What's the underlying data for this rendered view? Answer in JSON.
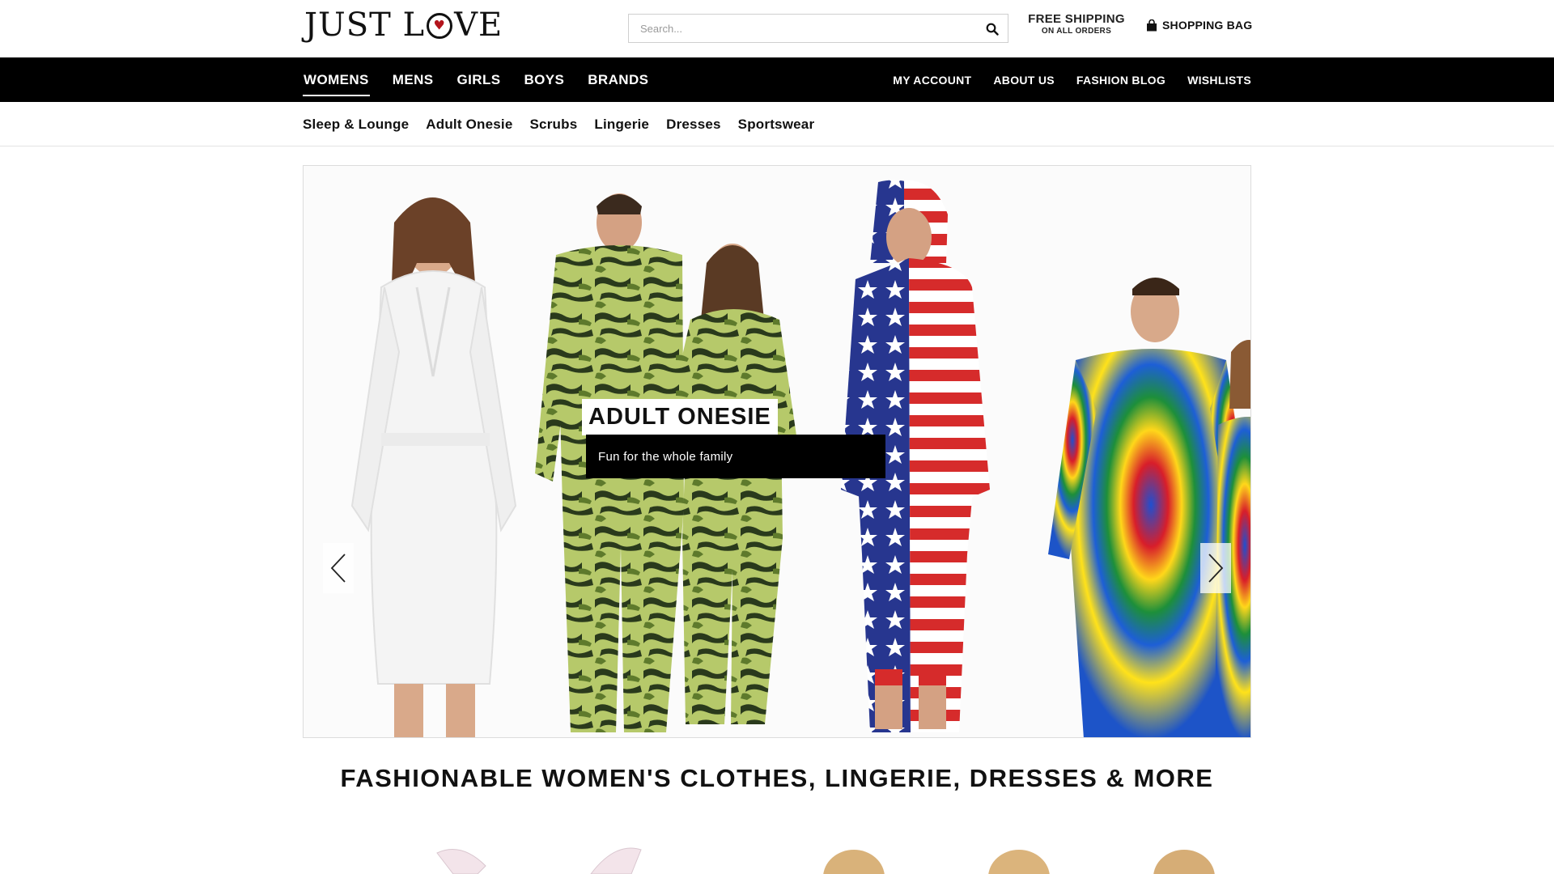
{
  "brand": {
    "logo_prefix": "JUST L",
    "logo_suffix": "VE",
    "heart_glyph": "♥",
    "heart_color": "#b3141c"
  },
  "search": {
    "placeholder": "Search...",
    "value": "",
    "icon": "search-icon"
  },
  "shipping": {
    "line1": "FREE SHIPPING",
    "line2": "ON ALL ORDERS"
  },
  "cart": {
    "label": "SHOPPING BAG",
    "icon": "shopping-bag-icon"
  },
  "main_nav": {
    "left": [
      {
        "label": "WOMENS",
        "active": true
      },
      {
        "label": "MENS",
        "active": false
      },
      {
        "label": "GIRLS",
        "active": false
      },
      {
        "label": "BOYS",
        "active": false
      },
      {
        "label": "BRANDS",
        "active": false
      }
    ],
    "right": [
      {
        "label": "MY ACCOUNT"
      },
      {
        "label": "ABOUT US"
      },
      {
        "label": "FASHION BLOG"
      },
      {
        "label": "WISHLISTS"
      }
    ]
  },
  "sub_nav": [
    {
      "label": "Sleep & Lounge"
    },
    {
      "label": "Adult Onesie"
    },
    {
      "label": "Scrubs"
    },
    {
      "label": "Lingerie"
    },
    {
      "label": "Dresses"
    },
    {
      "label": "Sportswear"
    }
  ],
  "hero": {
    "title": "ADULT ONESIE",
    "subtitle": "Fun for the whole family",
    "prev_icon": "chevron-left-icon",
    "next_icon": "chevron-right-icon"
  },
  "section": {
    "heading": "FASHIONABLE WOMEN'S CLOTHES, LINGERIE, DRESSES & MORE"
  },
  "colors": {
    "nav_bg": "#000000",
    "nav_text": "#ffffff",
    "accent": "#b3141c",
    "camo_dark": "#2a3a1c",
    "camo_light": "#b6c96a"
  }
}
